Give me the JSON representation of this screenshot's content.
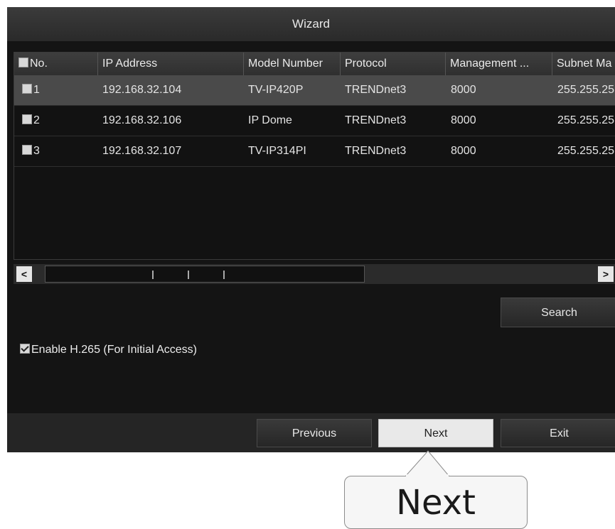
{
  "window": {
    "title": "Wizard"
  },
  "table": {
    "columns": [
      "No.",
      "IP Address",
      "Model Number",
      "Protocol",
      "Management ...",
      "Subnet Ma"
    ],
    "rows": [
      {
        "no": "1",
        "ip": "192.168.32.104",
        "model": "TV-IP420P",
        "protocol": "TRENDnet3",
        "port": "8000",
        "subnet": "255.255.25"
      },
      {
        "no": "2",
        "ip": "192.168.32.106",
        "model": "IP Dome",
        "protocol": "TRENDnet3",
        "port": "8000",
        "subnet": "255.255.25"
      },
      {
        "no": "3",
        "ip": "192.168.32.107",
        "model": "TV-IP314PI",
        "protocol": "TRENDnet3",
        "port": "8000",
        "subnet": "255.255.25"
      }
    ],
    "selected_row": 1
  },
  "scrollbar": {
    "left_glyph": "<",
    "right_glyph": ">"
  },
  "search_button": "Search",
  "enable_h265": {
    "label": "Enable H.265 (For Initial Access)",
    "checked": true
  },
  "nav": {
    "previous": "Previous",
    "next": "Next",
    "exit": "Exit",
    "active": "next"
  },
  "callout": {
    "text": "Next"
  }
}
